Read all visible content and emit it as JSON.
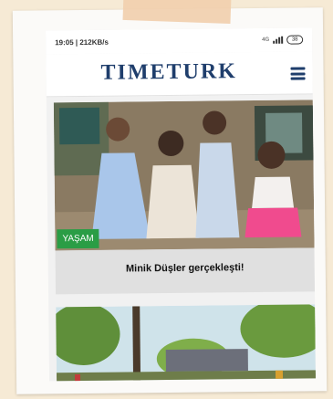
{
  "status_bar": {
    "time_speed": "19:05 | 212KB/s",
    "network": "4G",
    "battery": "38"
  },
  "header": {
    "logo": "TIMETURK",
    "menu_icon": "hamburger-menu-icon"
  },
  "articles": [
    {
      "category": "YAŞAM",
      "title": "Minik Düşler gerçekleşti!"
    }
  ],
  "colors": {
    "brand": "#1f3e6c",
    "category_badge": "#2a9d45",
    "background": "#f6ead5"
  }
}
